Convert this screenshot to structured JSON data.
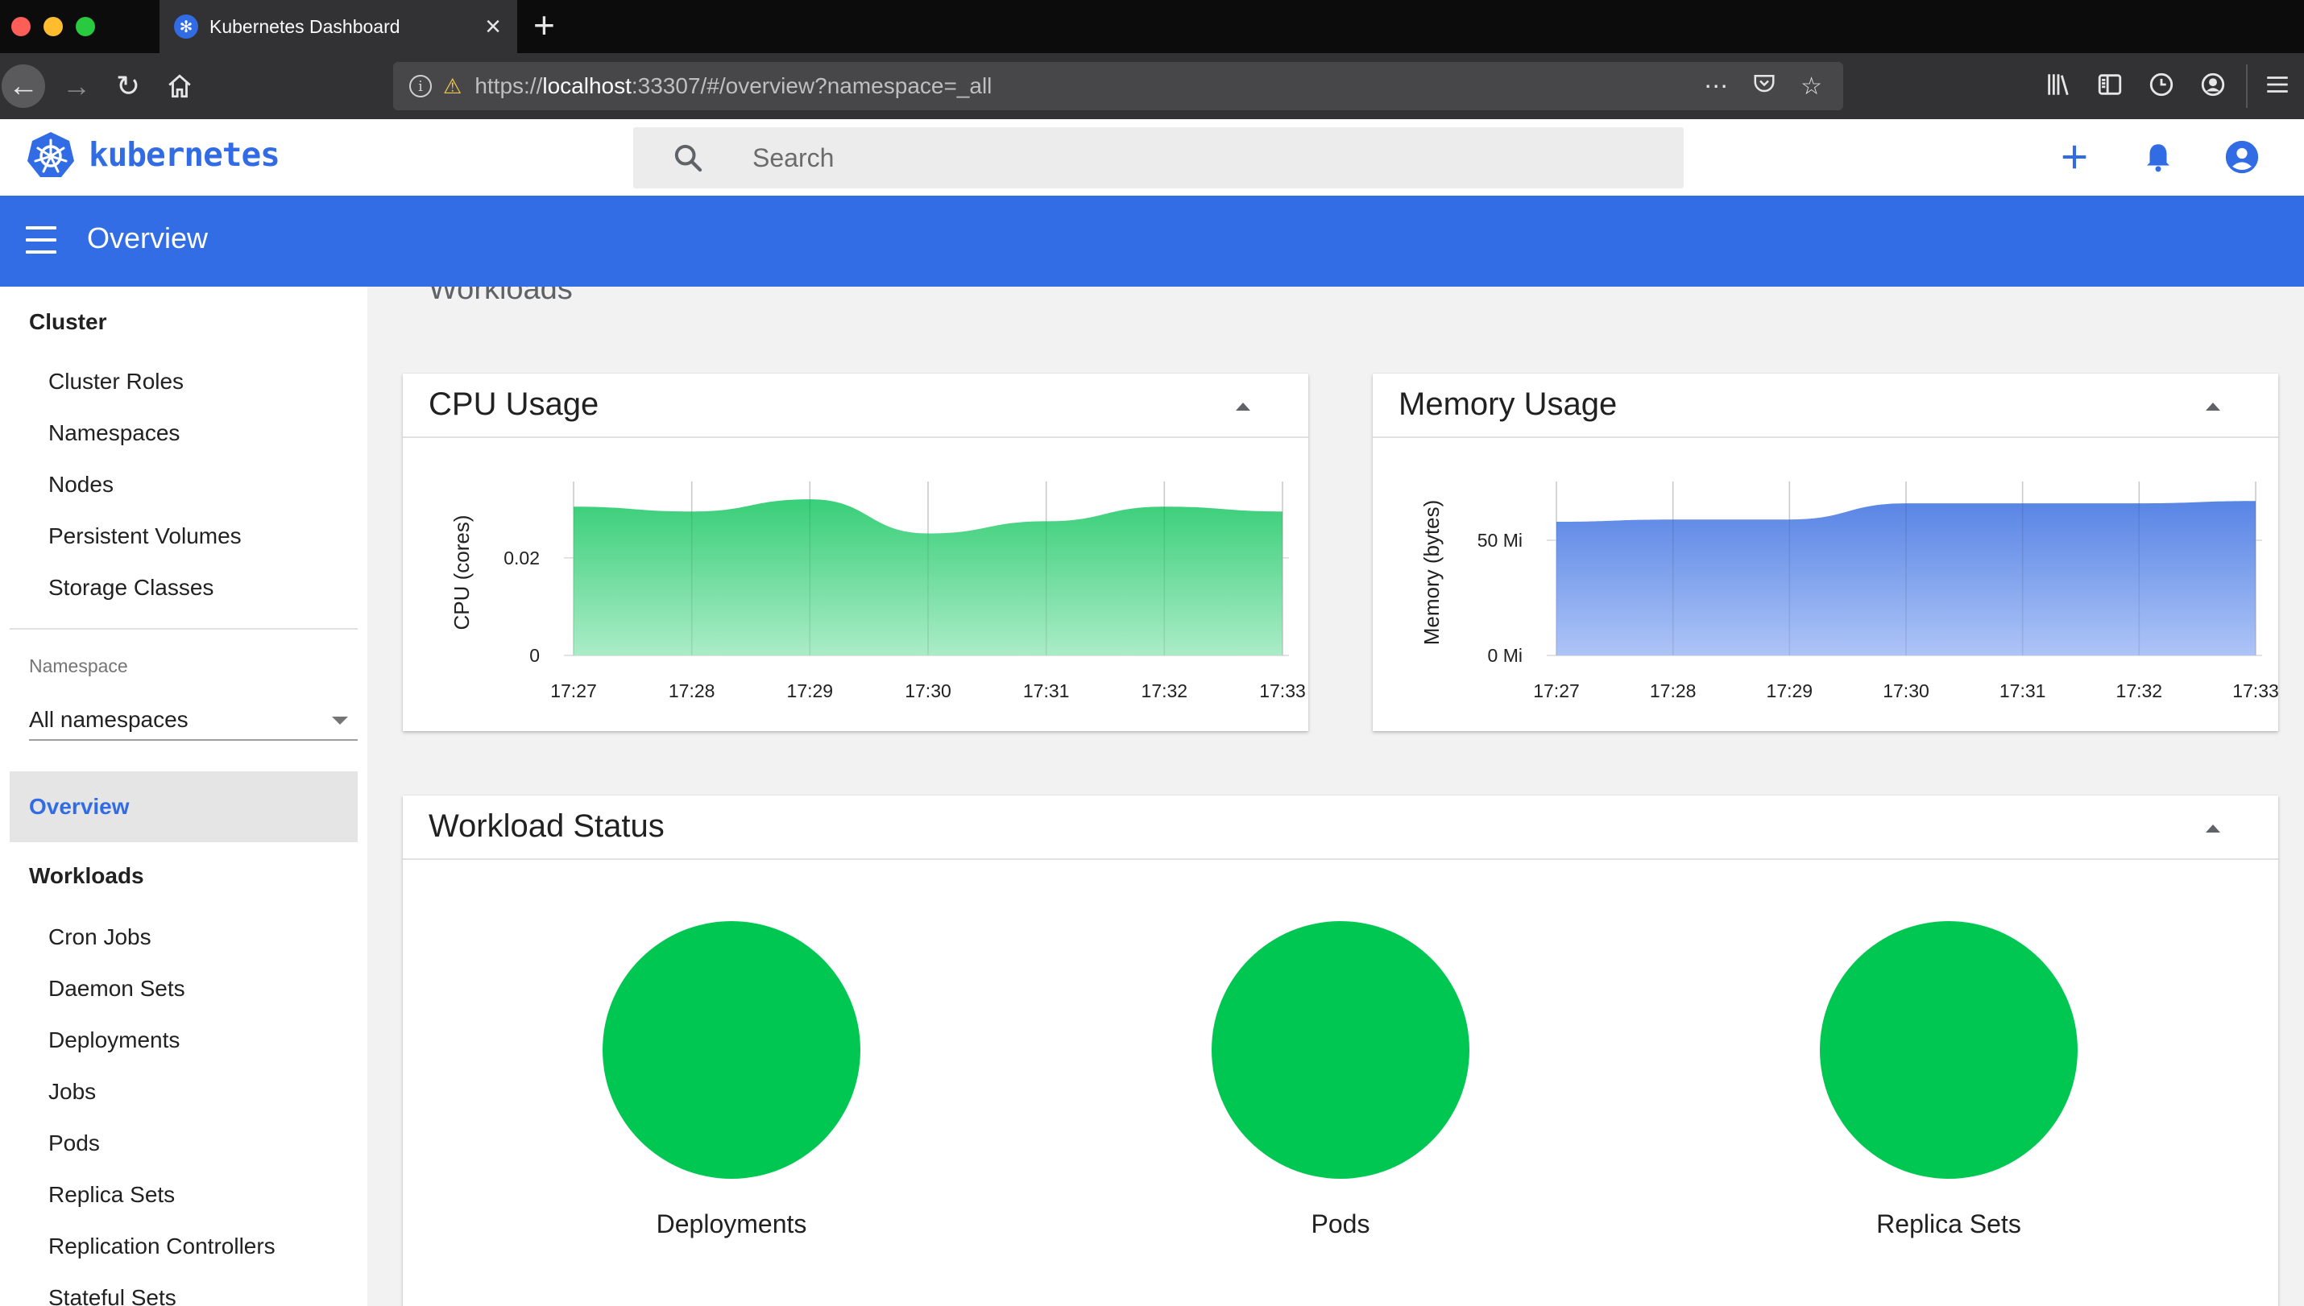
{
  "browser": {
    "tab_title": "Kubernetes Dashboard",
    "url_scheme_host": "https://",
    "url_host": "localhost",
    "url_rest": ":33307/#/overview?namespace=_all",
    "icons": [
      "back-arrow-icon",
      "forward-arrow-icon",
      "reload-icon",
      "home-icon",
      "info-icon",
      "lock-warning-icon",
      "more-icon",
      "pocket-icon",
      "star-icon",
      "library-icon",
      "sidebar-icon",
      "history-icon",
      "account-icon",
      "hamburger-menu-icon"
    ]
  },
  "header": {
    "brand": "kubernetes",
    "search_placeholder": "Search"
  },
  "toolbar": {
    "title": "Overview"
  },
  "sidebar": {
    "cluster_label": "Cluster",
    "cluster_items": [
      "Cluster Roles",
      "Namespaces",
      "Nodes",
      "Persistent Volumes",
      "Storage Classes"
    ],
    "namespace_label": "Namespace",
    "namespace_value": "All namespaces",
    "active_item": "Overview",
    "workloads_label": "Workloads",
    "workload_items": [
      "Cron Jobs",
      "Daemon Sets",
      "Deployments",
      "Jobs",
      "Pods",
      "Replica Sets",
      "Replication Controllers",
      "Stateful Sets"
    ]
  },
  "main": {
    "section_title": "Workloads",
    "cpu_card_title": "CPU Usage",
    "memory_card_title": "Memory Usage",
    "status_card_title": "Workload Status",
    "status_items": [
      "Deployments",
      "Pods",
      "Replica Sets"
    ]
  },
  "colors": {
    "accent": "#326ce5",
    "cpu_fill": "#2ecc71",
    "memory_fill": "#5b86e5",
    "status_ok": "#00c752"
  },
  "chart_data": [
    {
      "type": "area",
      "x": [
        "17:27",
        "17:28",
        "17:29",
        "17:30",
        "17:31",
        "17:32",
        "17:33"
      ],
      "series": [
        {
          "values": [
            0.0305,
            0.0295,
            0.032,
            0.025,
            0.0275,
            0.0305,
            0.0295
          ]
        }
      ],
      "xlabel": "",
      "ylabel": "CPU (cores)",
      "yticks": [
        "0",
        "0.02"
      ],
      "ylim": [
        0,
        0.034
      ],
      "grid": true
    },
    {
      "type": "area",
      "x": [
        "17:27",
        "17:28",
        "17:29",
        "17:30",
        "17:31",
        "17:32",
        "17:33"
      ],
      "series": [
        {
          "values": [
            58,
            59,
            59,
            66,
            66,
            66,
            67
          ]
        }
      ],
      "xlabel": "",
      "ylabel": "Memory (bytes)",
      "yticks": [
        "0 Mi",
        "50 Mi"
      ],
      "ylim": [
        0,
        72
      ],
      "grid": true
    }
  ]
}
